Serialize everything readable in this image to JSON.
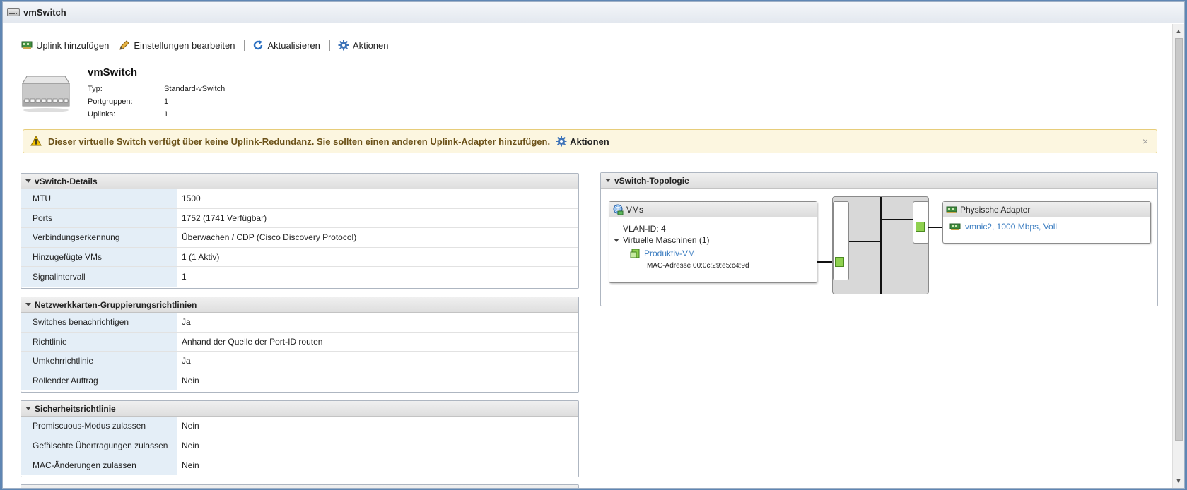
{
  "window": {
    "title": "vmSwitch"
  },
  "toolbar": {
    "add_uplink": "Uplink hinzufügen",
    "edit_settings": "Einstellungen bearbeiten",
    "refresh": "Aktualisieren",
    "actions": "Aktionen"
  },
  "summary": {
    "name": "vmSwitch",
    "rows": [
      {
        "label": "Typ:",
        "value": "Standard-vSwitch"
      },
      {
        "label": "Portgruppen:",
        "value": "1"
      },
      {
        "label": "Uplinks:",
        "value": "1"
      }
    ]
  },
  "warning": {
    "text": "Dieser virtuelle Switch verfügt über keine Uplink-Redundanz. Sie sollten einen anderen Uplink-Adapter hinzufügen.",
    "action": "Aktionen",
    "close": "×"
  },
  "details": {
    "title": "vSwitch-Details",
    "rows": [
      {
        "label": "MTU",
        "value": "1500"
      },
      {
        "label": "Ports",
        "value": "1752 (1741 Verfügbar)"
      },
      {
        "label": "Verbindungserkennung",
        "value": "Überwachen / CDP (Cisco Discovery Protocol)"
      },
      {
        "label": "Hinzugefügte VMs",
        "value": "1 (1 Aktiv)"
      },
      {
        "label": "Signalintervall",
        "value": "1"
      }
    ]
  },
  "teaming": {
    "title": "Netzwerkkarten-Gruppierungsrichtlinien",
    "rows": [
      {
        "label": "Switches benachrichtigen",
        "value": "Ja"
      },
      {
        "label": "Richtlinie",
        "value": "Anhand der Quelle der Port-ID routen"
      },
      {
        "label": "Umkehrrichtlinie",
        "value": "Ja"
      },
      {
        "label": "Rollender Auftrag",
        "value": "Nein"
      }
    ]
  },
  "security": {
    "title": "Sicherheitsrichtlinie",
    "rows": [
      {
        "label": "Promiscuous-Modus zulassen",
        "value": "Nein"
      },
      {
        "label": "Gefälschte Übertragungen zulassen",
        "value": "Nein"
      },
      {
        "label": "MAC-Änderungen zulassen",
        "value": "Nein"
      }
    ]
  },
  "topology": {
    "title": "vSwitch-Topologie",
    "vms": {
      "title": "VMs",
      "vlan": "VLAN-ID: 4",
      "group": "Virtuelle Maschinen (1)",
      "vm_name": "Produktiv-VM",
      "mac": "MAC-Adresse 00:0c:29:e5:c4:9d"
    },
    "adapters": {
      "title": "Physische Adapter",
      "nic": "vmnic2, 1000 Mbps, Voll"
    }
  },
  "colors": {
    "accent": "#3a7cc0",
    "warning_bg": "#fcf6e0",
    "label_bg": "#e4eef7",
    "port_green": "#8fd14f"
  }
}
